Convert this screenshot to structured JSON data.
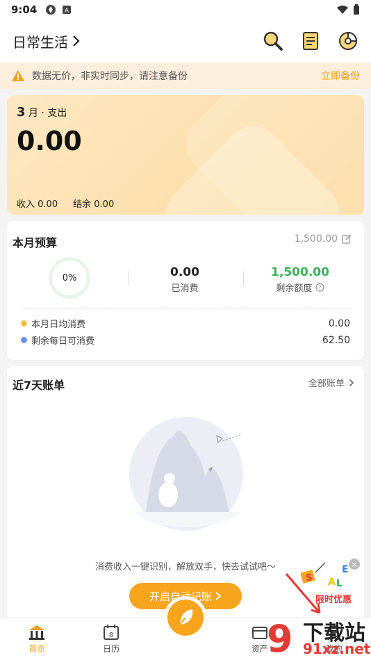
{
  "status_bar": {
    "time": "9:04"
  },
  "header": {
    "title": "日常生活",
    "chevron": ">"
  },
  "notice": {
    "text": "数据无价，非实时同步，请注意备份",
    "action": "立即备份"
  },
  "summary": {
    "month_num": "3",
    "month_suffix": "月 · 支出",
    "amount": "0.00",
    "income_label": "收入",
    "income_value": "0.00",
    "balance_label": "结余",
    "balance_value": "0.00"
  },
  "budget": {
    "title": "本月预算",
    "total": "1,500.00",
    "percent": "0%",
    "spent_value": "0.00",
    "spent_label": "已消费",
    "remain_value": "1,500.00",
    "remain_label": "剩余额度",
    "daily_avg_label": "本月日均消费",
    "daily_avg_value": "0.00",
    "daily_avail_label": "剩余每日可消费",
    "daily_avail_value": "62.50",
    "colors": {
      "remain": "#3fae5a",
      "dot_avg": "#f2c14e",
      "dot_avail": "#6b8cf0"
    }
  },
  "bills": {
    "title": "近7天账单",
    "all_label": "全部账单",
    "tip": "消费收入一键识别，解放双手，快去试试吧～",
    "cta": "开启自动记账"
  },
  "promo": {
    "label": "限时优惠"
  },
  "tabbar": {
    "tabs": [
      {
        "label": "首页"
      },
      {
        "label": "日历"
      },
      {
        "label": "资产"
      },
      {
        "label": "我的"
      }
    ]
  },
  "watermark": {
    "line1": "下载站",
    "line2": "91xz.net"
  },
  "colors": {
    "accent": "#f7a51c",
    "notice_bg": "#fbeedd"
  }
}
